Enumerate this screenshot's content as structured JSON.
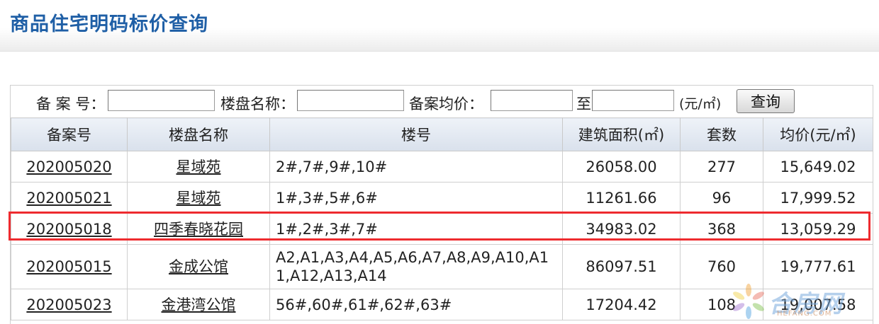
{
  "page_title": "商品住宅明码标价查询",
  "search": {
    "record_no_label": "备 案 号：",
    "record_no_value": "",
    "project_name_label": "楼盘名称：",
    "project_name_value": "",
    "avg_price_label": "备案均价：",
    "avg_price_from": "",
    "to_label": "至",
    "avg_price_to": "",
    "unit_label": "(元/㎡)",
    "query_button": "查询"
  },
  "table": {
    "headers": [
      "备案号",
      "楼盘名称",
      "楼号",
      "建筑面积(㎡)",
      "套数",
      "均价(元/㎡)"
    ],
    "rows": [
      {
        "record_no": "202005020",
        "project": "星域苑",
        "buildings": "2#,7#,9#,10#",
        "area": "26058.00",
        "units": "277",
        "avg_price": "15,649.02"
      },
      {
        "record_no": "202005021",
        "project": "星域苑",
        "buildings": "1#,3#,5#,6#",
        "area": "11261.66",
        "units": "96",
        "avg_price": "17,999.52"
      },
      {
        "record_no": "202005018",
        "project": "四季春晓花园",
        "buildings": "1#,2#,3#,7#",
        "area": "34983.02",
        "units": "368",
        "avg_price": "13,059.29"
      },
      {
        "record_no": "202005015",
        "project": "金成公馆",
        "buildings": "A2,A1,A3,A4,A5,A6,A7,A8,A9,A10,A11,A12,A13,A14",
        "area": "86097.51",
        "units": "760",
        "avg_price": "19,777.61"
      },
      {
        "record_no": "202005023",
        "project": "金港湾公馆",
        "buildings": "56#,60#,61#,62#,63#",
        "area": "17204.42",
        "units": "108",
        "avg_price": "19,007.58"
      }
    ]
  },
  "highlight_color": "#ee2b2f",
  "watermark": {
    "text": "合房网",
    "sub": "HEFANG.COM"
  }
}
